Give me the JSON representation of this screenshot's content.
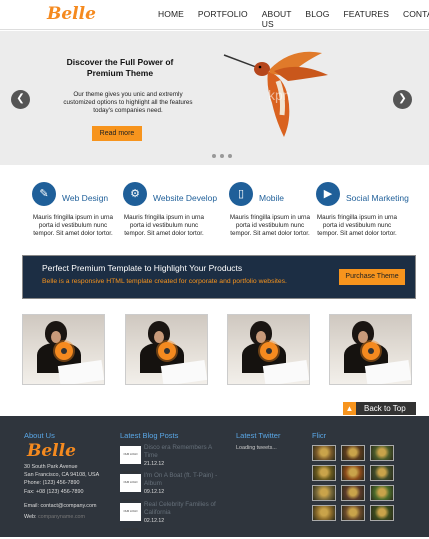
{
  "header": {
    "logo": "Belle",
    "nav": [
      "HOME",
      "PORTFOLIO",
      "ABOUT US",
      "BLOG",
      "FEATURES",
      "CONTACT"
    ]
  },
  "hero": {
    "title": "Discover the Full Power of Premium Theme",
    "text": "Our theme gives you unic and extremly customized options to highlight all the features today's companies need.",
    "button": "Read more",
    "watermark": "kpn",
    "prev_icon": "chevron-left-icon",
    "next_icon": "chevron-right-icon",
    "slide_count": 3
  },
  "services": [
    {
      "title": "Web Design",
      "icon": "brush-icon",
      "text": "Mauris fringilla ipsum in urna porta id vestibulum nunc tempor. Sit amet dolor tortor."
    },
    {
      "title": "Website Develop",
      "icon": "gears-icon",
      "text": "Mauris fringilla ipsum in urna porta id vestibulum nunc tempor. Sit amet dolor tortor."
    },
    {
      "title": "Mobile",
      "icon": "mobile-icon",
      "text": "Mauris fringilla ipsum in urna porta id vestibulum nunc tempor. Sit amet dolor tortor."
    },
    {
      "title": "Social Marketing",
      "icon": "megaphone-icon",
      "text": "Mauris fringilla ipsum in urna porta id vestibulum nunc tempor. Sit amet dolor tortor."
    }
  ],
  "banner": {
    "title": "Perfect Premium Template to Highlight Your Products",
    "subtitle": "Belle is a responsive HTML template created for corporate and portfolio websites.",
    "button": "Purchase Theme"
  },
  "portfolio_count": 4,
  "back_to_top": "Back to Top",
  "footer": {
    "about": {
      "heading": "About Us",
      "logo": "Belle",
      "address": "30 South Park Avenue",
      "city": "San Francisco, CA 94108, USA",
      "phone": "Phone: (123) 456-7890",
      "fax": "Fax: +08 (123) 456-7890",
      "email_label": "Email:",
      "email": "contact@company.com",
      "web_label": "Web:",
      "web": "companyname.com"
    },
    "blog": {
      "heading": "Latest Blog Posts",
      "thumb_text": "OUR LOGO GOES HERE",
      "posts": [
        {
          "title": "Disco era Remembers A Time",
          "date": "21.12.12"
        },
        {
          "title": "I'm On A Boat (ft. T-Pain) - Album",
          "date": "09.12.12"
        },
        {
          "title": "Real Celebrity Families of California",
          "date": "02.12.12"
        }
      ]
    },
    "twitter": {
      "heading": "Latest Twitter",
      "status": "Loading tweets..."
    },
    "flickr": {
      "heading": "Flicr",
      "colors": [
        "#7a5a2a",
        "#5b3b1e",
        "#4a5a2a",
        "#6a5a1e",
        "#8a4a1a",
        "#3e4a2a",
        "#7a6a3a",
        "#5a3a2a",
        "#4a6a2a",
        "#8a6a2a",
        "#6a4a2a",
        "#3a4a1e"
      ]
    }
  }
}
